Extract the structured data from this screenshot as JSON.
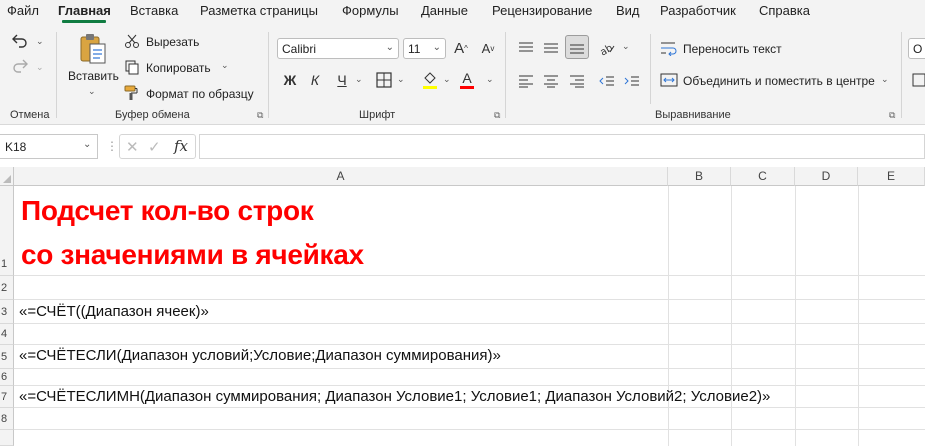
{
  "menu": {
    "items": [
      "Файл",
      "Главная",
      "Вставка",
      "Разметка страницы",
      "Формулы",
      "Данные",
      "Рецензирование",
      "Вид",
      "Разработчик",
      "Справка"
    ]
  },
  "ribbon": {
    "undo_group": {
      "label": "Отмена"
    },
    "clipboard": {
      "label": "Буфер обмена",
      "paste": "Вставить",
      "cut": "Вырезать",
      "copy": "Копировать",
      "format_painter": "Формат по образцу"
    },
    "font": {
      "label": "Шрифт",
      "name": "Calibri",
      "size": "11",
      "bold": "Ж",
      "italic": "К",
      "underline": "Ч"
    },
    "alignment": {
      "label": "Выравнивание",
      "wrap_text": "Переносить текст",
      "merge_center": "Объединить и поместить в центре"
    },
    "number": {
      "partial": "О"
    }
  },
  "formula_bar": {
    "name_box": "K18",
    "fx": "fx",
    "content": ""
  },
  "grid": {
    "columns": [
      "A",
      "B",
      "C",
      "D",
      "E"
    ],
    "rows": [
      "1",
      "2",
      "3",
      "4",
      "5",
      "6",
      "7",
      "8"
    ],
    "cells": {
      "a1_line1": "Подсчет кол-во строк",
      "a1_line2": "со значениями в ячейках",
      "a3": "«=СЧЁТ((Диапазон ячеек)»",
      "a5": "«=СЧЁТЕСЛИ(Диапазон условий;Условие;Диапазон суммирования)»",
      "a7": "«=СЧЁТЕСЛИМН(Диапазон суммирования; Диапазон Условие1; Условие1; Диапазон Условий2; Условие2)»"
    }
  },
  "colors": {
    "accent": "#107c41",
    "heading_red": "#ff0000"
  }
}
